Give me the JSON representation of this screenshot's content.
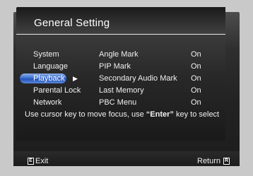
{
  "window": {
    "title": "General Setting"
  },
  "menu": {
    "items": [
      {
        "label": "System"
      },
      {
        "label": "Language"
      },
      {
        "label": "Playback"
      },
      {
        "label": "Parental Lock"
      },
      {
        "label": "Network"
      }
    ],
    "selected": "Playback",
    "selected_marker": "▶"
  },
  "options": [
    {
      "label": "Angle Mark",
      "value": "On"
    },
    {
      "label": "PIP Mark",
      "value": "On"
    },
    {
      "label": "Secondary Audio Mark",
      "value": "On"
    },
    {
      "label": "Last Memory",
      "value": "On"
    },
    {
      "label": "PBC Menu",
      "value": "On"
    }
  ],
  "help": {
    "part1": "Use cursor key to move focus, use ",
    "quoted": "“Enter”",
    "part2": " key to select"
  },
  "footer": {
    "exit_label": "Exit",
    "exit_icon": "exit-key-icon",
    "return_label": "Return",
    "return_icon": "return-key-icon"
  },
  "colors": {
    "highlight": "#3d6fd0",
    "background": "#c9c9c9",
    "panel": "#222222",
    "text": "#f0f0f0"
  }
}
